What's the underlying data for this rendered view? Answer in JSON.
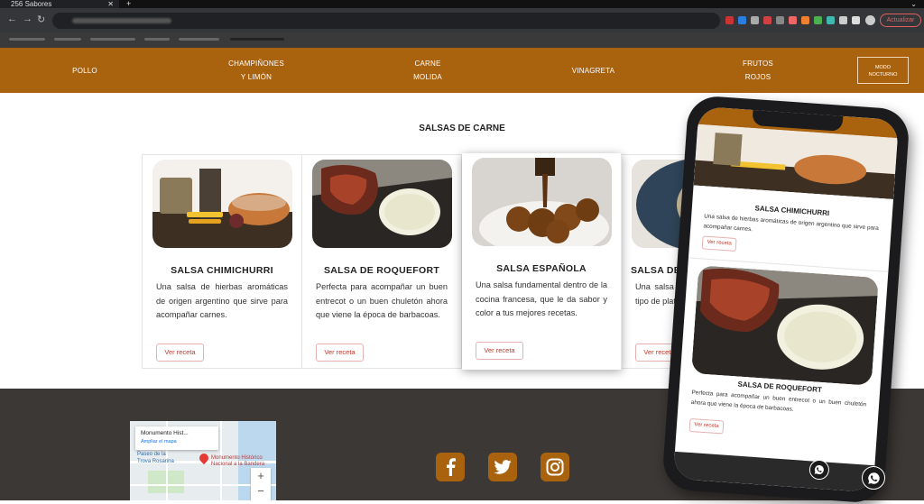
{
  "browser": {
    "tab_title": "256 Sabores",
    "new_tab": "+",
    "update_label": "Actualizar"
  },
  "nav": {
    "items": [
      {
        "line1": "POLLO",
        "line2": ""
      },
      {
        "line1": "CHAMPIÑONES",
        "line2": "Y LIMÓN"
      },
      {
        "line1": "CARNE",
        "line2": "MOLIDA"
      },
      {
        "line1": "VINAGRETA",
        "line2": ""
      },
      {
        "line1": "FRUTOS",
        "line2": "ROJOS"
      }
    ],
    "mode_line1": "MODO",
    "mode_line2": "NOCTURNO"
  },
  "section": {
    "title": "SALSAS DE CARNE"
  },
  "cards": [
    {
      "title": "SALSA CHIMICHURRI",
      "text": "Una salsa de hierbas aromáticas de origen argentino que sirve para acompañar carnes.",
      "button": "Ver receta"
    },
    {
      "title": "SALSA DE ROQUEFORT",
      "text": "Perfecta para acompañar un buen entrecot o un buen chuletón ahora que viene la época de barbacoas.",
      "button": "Ver receta"
    },
    {
      "title": "SALSA ESPAÑOLA",
      "text": "Una salsa fundamental dentro de la cocina francesa, que le da sabor y color a tus mejores recetas.",
      "button": "Ver receta"
    },
    {
      "title": "SALSA DE CHA",
      "text": "Una salsa básica de la cocina fra tipo de platos.",
      "button": "Ver receta"
    }
  ],
  "map": {
    "place": "Monumento Hist...",
    "enlarge": "Ampliar el mapa",
    "label1": "Paseo de la",
    "label2": "Trova Rosarina",
    "label3": "Monumento Histórico",
    "label4": "Nacional a la Bandera",
    "zoom_in": "+",
    "zoom_out": "−"
  },
  "phone": {
    "card1_title": "SALSA CHIMICHURRI",
    "card1_text": "Una salsa de hierbas aromáticas de origen argentino que sirve para acompañar carnes.",
    "card1_button": "Ver receta",
    "card2_title": "SALSA DE ROQUEFORT",
    "card2_text": "Perfecta para acompañar un buen entrecot o un buen chuletón ahora que viene la época de barbacoas.",
    "card2_button": "Ver receta"
  },
  "colors": {
    "brand": "#a9620e",
    "footer": "#3c3835",
    "button_text": "#c0392b"
  },
  "icons": [
    "facebook-icon",
    "twitter-icon",
    "instagram-icon",
    "whatsapp-icon"
  ]
}
